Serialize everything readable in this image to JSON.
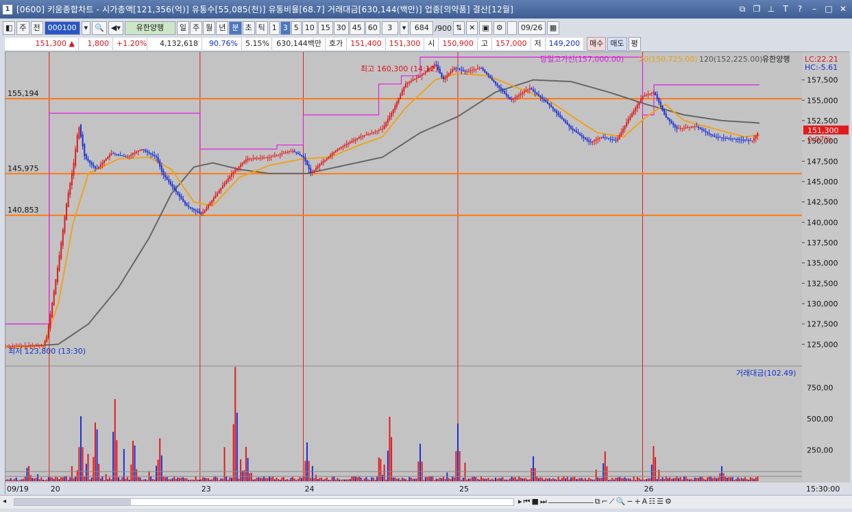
{
  "title": {
    "icon": "1",
    "text": "[0600] 키움종합차트 - 시가총액[121,356(억)] 유통수[55,085(천)] 유통비율[68.7] 거래대금[630,144(백만)] 업종[의약품] 결산[12월]"
  },
  "toolbar": {
    "period": "주",
    "prev": "전",
    "code": "000100",
    "name": "유한양행",
    "tf": [
      "일",
      "주",
      "월",
      "년",
      "분",
      "초",
      "틱"
    ],
    "active_tf": "분",
    "ticks": [
      "1",
      "3",
      "5",
      "10",
      "15",
      "30",
      "45",
      "60"
    ],
    "active_tick": "3",
    "count": "3",
    "range": "684",
    "range_total": "/900",
    "date": "09/26"
  },
  "quote": {
    "price": "151,300",
    "arrow": "▲",
    "change": "1,800",
    "pct": "+1.20%",
    "volume": "4,132,618",
    "vol_ratio": "90.76%",
    "turnover": "5.15%",
    "amount": "630,144백만",
    "hoga_label": "호가",
    "bid": "151,400",
    "ask": "151,300",
    "open_label": "시",
    "open": "150,900",
    "high_label": "고",
    "high": "157,000",
    "low_label": "저",
    "low": "149,200",
    "buy": "매수",
    "sell": "매도",
    "eval": "평"
  },
  "legend": {
    "line1": "당일고가선(157,000.00)",
    "ma20": "20(150,725.00)",
    "ma120": "120(152,225.00)",
    "name": "유한양행",
    "lc": "LC:22.21",
    "hc": "HC:-5.61",
    "vol": "거래대금(102.49)"
  },
  "annot": {
    "max": "최고 160,300 (14:12)",
    "min": "최저 123,800 (13:30)"
  },
  "hlines": [
    {
      "label": "155,194",
      "value": 155194
    },
    {
      "label": "145,975",
      "value": 145975
    },
    {
      "label": "140,853",
      "value": 140853
    }
  ],
  "current": {
    "price": "151,300",
    "pct": "0.07%"
  },
  "yticks": [
    {
      "v": 157500,
      "l": "157,500"
    },
    {
      "v": 155000,
      "l": "155,000"
    },
    {
      "v": 152500,
      "l": "152,500"
    },
    {
      "v": 150000,
      "l": "150,000"
    },
    {
      "v": 147500,
      "l": "147,500"
    },
    {
      "v": 145000,
      "l": "145,000"
    },
    {
      "v": 142500,
      "l": "142,500"
    },
    {
      "v": 140000,
      "l": "140,000"
    },
    {
      "v": 137500,
      "l": "137,500"
    },
    {
      "v": 135000,
      "l": "135,000"
    },
    {
      "v": 132500,
      "l": "132,500"
    },
    {
      "v": 130000,
      "l": "130,000"
    },
    {
      "v": 127500,
      "l": "127,500"
    },
    {
      "v": 125000,
      "l": "125,000"
    }
  ],
  "vticks": [
    {
      "v": 750,
      "l": "750,00"
    },
    {
      "v": 500,
      "l": "500,00"
    },
    {
      "v": 250,
      "l": "250,00"
    }
  ],
  "xlabels": [
    "09/19",
    "20",
    "23",
    "24",
    "25",
    "26"
  ],
  "time": "15:30:00",
  "chart_data": {
    "type": "candlestick",
    "symbol": "유한양행",
    "day_high": 157000,
    "max": 160300,
    "min": 123800,
    "last": 151300,
    "price_path": [
      [
        0.0,
        124800
      ],
      [
        0.3,
        124800
      ],
      [
        0.5,
        124900
      ],
      [
        0.55,
        126000
      ],
      [
        0.7,
        135000
      ],
      [
        0.82,
        143000
      ],
      [
        0.9,
        147000
      ],
      [
        0.97,
        152000
      ],
      [
        1.05,
        148000
      ],
      [
        1.2,
        146500
      ],
      [
        1.4,
        148500
      ],
      [
        1.6,
        148000
      ],
      [
        1.8,
        149000
      ],
      [
        2.0,
        148000
      ],
      [
        2.08,
        146000
      ],
      [
        2.2,
        144500
      ],
      [
        2.4,
        142000
      ],
      [
        2.6,
        141000
      ],
      [
        2.8,
        143500
      ],
      [
        3.0,
        146000
      ],
      [
        3.2,
        147800
      ],
      [
        3.5,
        148000
      ],
      [
        3.8,
        148800
      ],
      [
        3.95,
        148000
      ],
      [
        4.05,
        146000
      ],
      [
        4.15,
        147000
      ],
      [
        4.4,
        149000
      ],
      [
        4.7,
        150500
      ],
      [
        5.0,
        151500
      ],
      [
        5.15,
        154000
      ],
      [
        5.3,
        157000
      ],
      [
        5.5,
        158000
      ],
      [
        5.7,
        159500
      ],
      [
        5.8,
        157500
      ],
      [
        5.95,
        159000
      ],
      [
        6.1,
        158500
      ],
      [
        6.3,
        159000
      ],
      [
        6.5,
        157000
      ],
      [
        6.7,
        155000
      ],
      [
        6.95,
        156500
      ],
      [
        7.2,
        154500
      ],
      [
        7.5,
        151500
      ],
      [
        7.75,
        149800
      ],
      [
        7.9,
        150500
      ],
      [
        8.1,
        150000
      ],
      [
        8.25,
        152500
      ],
      [
        8.45,
        155500
      ],
      [
        8.6,
        156000
      ],
      [
        8.75,
        153000
      ],
      [
        8.9,
        151500
      ],
      [
        9.15,
        151800
      ],
      [
        9.4,
        150500
      ],
      [
        9.7,
        150200
      ],
      [
        9.9,
        150000
      ],
      [
        10.0,
        151300
      ]
    ],
    "ma20_path": [
      [
        0.0,
        124600
      ],
      [
        0.5,
        124800
      ],
      [
        0.7,
        130000
      ],
      [
        0.9,
        140000
      ],
      [
        1.1,
        146000
      ],
      [
        1.5,
        147800
      ],
      [
        1.9,
        148000
      ],
      [
        2.2,
        146500
      ],
      [
        2.5,
        142500
      ],
      [
        2.75,
        142000
      ],
      [
        3.1,
        145500
      ],
      [
        3.5,
        147000
      ],
      [
        3.95,
        147800
      ],
      [
        4.3,
        148000
      ],
      [
        4.7,
        149500
      ],
      [
        5.0,
        150500
      ],
      [
        5.3,
        154000
      ],
      [
        5.7,
        157500
      ],
      [
        6.0,
        158300
      ],
      [
        6.4,
        158000
      ],
      [
        6.8,
        156500
      ],
      [
        7.2,
        155000
      ],
      [
        7.6,
        152500
      ],
      [
        7.85,
        151000
      ],
      [
        8.2,
        150500
      ],
      [
        8.5,
        153000
      ],
      [
        8.75,
        154500
      ],
      [
        9.0,
        152500
      ],
      [
        9.4,
        151500
      ],
      [
        9.8,
        150500
      ],
      [
        10.0,
        150700
      ]
    ],
    "ma120_path": [
      [
        0.0,
        124600
      ],
      [
        0.7,
        125000
      ],
      [
        1.1,
        127500
      ],
      [
        1.5,
        132000
      ],
      [
        1.9,
        138000
      ],
      [
        2.2,
        143500
      ],
      [
        2.5,
        146800
      ],
      [
        2.75,
        147300
      ],
      [
        3.1,
        146500
      ],
      [
        3.5,
        146000
      ],
      [
        4.0,
        146000
      ],
      [
        4.5,
        147000
      ],
      [
        5.0,
        148000
      ],
      [
        5.5,
        151000
      ],
      [
        6.0,
        153000
      ],
      [
        6.5,
        156000
      ],
      [
        7.0,
        157500
      ],
      [
        7.5,
        157300
      ],
      [
        8.0,
        156000
      ],
      [
        8.5,
        154500
      ],
      [
        9.0,
        153200
      ],
      [
        9.5,
        152500
      ],
      [
        10.0,
        152200
      ]
    ],
    "ylim": [
      122500,
      160500
    ],
    "vol_ylim": [
      0,
      900
    ],
    "vol_spikes": [
      [
        0.3,
        150
      ],
      [
        1.0,
        520
      ],
      [
        1.2,
        580
      ],
      [
        1.45,
        690
      ],
      [
        1.7,
        400
      ],
      [
        2.05,
        360
      ],
      [
        3.05,
        960
      ],
      [
        3.2,
        260
      ],
      [
        4.0,
        310
      ],
      [
        5.1,
        570
      ],
      [
        5.5,
        300
      ],
      [
        6.0,
        460
      ],
      [
        7.0,
        200
      ],
      [
        7.95,
        250
      ],
      [
        8.6,
        310
      ],
      [
        9.5,
        120
      ]
    ]
  }
}
